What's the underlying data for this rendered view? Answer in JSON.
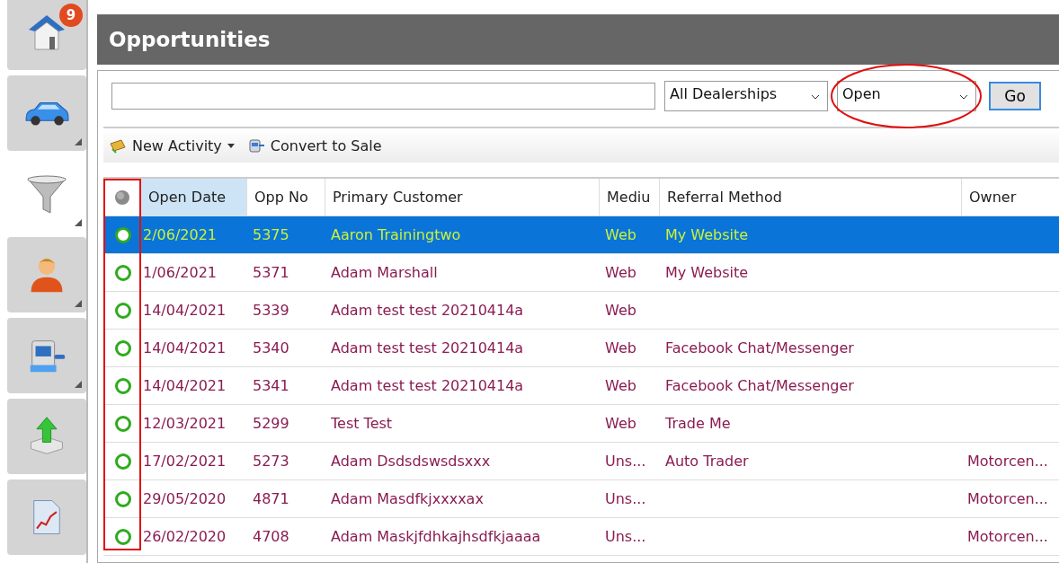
{
  "sidebar": {
    "items": [
      {
        "kind": "home",
        "selected": false,
        "has_menu": false,
        "badge": "9"
      },
      {
        "kind": "car",
        "selected": false,
        "has_menu": true
      },
      {
        "kind": "funnel",
        "selected": true,
        "has_menu": true
      },
      {
        "kind": "person",
        "selected": false,
        "has_menu": true
      },
      {
        "kind": "register",
        "selected": false,
        "has_menu": true
      },
      {
        "kind": "export",
        "selected": false,
        "has_menu": false
      },
      {
        "kind": "report",
        "selected": false,
        "has_menu": false
      }
    ]
  },
  "title": "Opportunities",
  "filter": {
    "dealership": {
      "value": "All Dealerships"
    },
    "status": {
      "value": "Open",
      "highlighted": true
    },
    "go_button": "Go"
  },
  "toolbar": [
    {
      "kind": "activity",
      "label": "New Activity",
      "has_menu": true
    },
    {
      "kind": "convert",
      "label": "Convert to Sale",
      "has_menu": false
    }
  ],
  "table": {
    "status_highlighted": true,
    "columns": [
      {
        "label": "Open Date",
        "sorted": true
      },
      {
        "label": "Opp No",
        "sorted": false
      },
      {
        "label": "Primary Customer",
        "sorted": false
      },
      {
        "label": "Mediu",
        "sorted": false
      },
      {
        "label": "Referral Method",
        "sorted": false
      },
      {
        "label": "Owner",
        "sorted": false
      }
    ],
    "rows": [
      {
        "selected": true,
        "cells": [
          "2/06/2021",
          "5375",
          "Aaron Trainingtwo",
          "Web",
          "My Website",
          ""
        ]
      },
      {
        "selected": false,
        "cells": [
          "1/06/2021",
          "5371",
          "Adam Marshall",
          "Web",
          "My Website",
          ""
        ]
      },
      {
        "selected": false,
        "cells": [
          "14/04/2021",
          "5339",
          "Adam test test 20210414a",
          "Web",
          "",
          ""
        ]
      },
      {
        "selected": false,
        "cells": [
          "14/04/2021",
          "5340",
          "Adam test test 20210414a",
          "Web",
          "Facebook Chat/Messenger",
          ""
        ]
      },
      {
        "selected": false,
        "cells": [
          "14/04/2021",
          "5341",
          "Adam test test 20210414a",
          "Web",
          "Facebook Chat/Messenger",
          ""
        ]
      },
      {
        "selected": false,
        "cells": [
          "12/03/2021",
          "5299",
          "Test Test",
          "Web",
          "Trade Me",
          ""
        ]
      },
      {
        "selected": false,
        "cells": [
          "17/02/2021",
          "5273",
          "Adam Dsdsdswsdsxxx",
          "Uns...",
          "Auto Trader",
          "Motorcen..."
        ]
      },
      {
        "selected": false,
        "cells": [
          "29/05/2020",
          "4871",
          "Adam Masdfkjxxxxax",
          "Uns...",
          "",
          "Motorcen..."
        ]
      },
      {
        "selected": false,
        "cells": [
          "26/02/2020",
          "4708",
          "Adam Maskjfdhkajhsdfkjaaaa",
          "Uns...",
          "",
          "Motorcen..."
        ]
      }
    ]
  }
}
